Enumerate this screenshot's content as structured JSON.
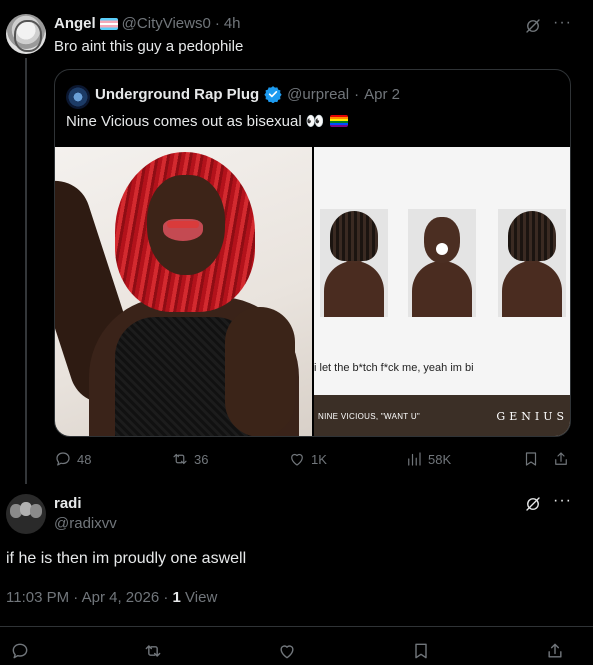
{
  "tweet1": {
    "display_name": "Angel",
    "handle": "@CityViews0",
    "time": "4h",
    "text": "Bro aint this guy a pedophile",
    "actions": {
      "replies": "48",
      "reposts": "36",
      "likes": "1K",
      "views": "58K"
    }
  },
  "quote": {
    "display_name": "Underground Rap Plug",
    "handle": "@urpreal",
    "date": "Apr 2",
    "text": "Nine Vicious comes out as bisexual 👀",
    "media_right": {
      "lyric": "i let the b*tch f*ck me, yeah im bi",
      "song": "NINE VICIOUS, \"WANT U\"",
      "brand": "GENIUS"
    }
  },
  "tweet2": {
    "display_name": "radi",
    "handle": "@radixvv",
    "text": "if he is then im proudly one aswell",
    "time": "11:03 PM",
    "date": "Apr 4, 2026",
    "views_count": "1",
    "views_label": "View"
  },
  "separator": "·",
  "icons": {
    "grok": "grok-icon",
    "more": "more-icon",
    "reply": "reply-icon",
    "repost": "repost-icon",
    "like": "like-icon",
    "views": "views-icon",
    "bookmark": "bookmark-icon",
    "share": "share-icon",
    "verified": "verified-badge-icon"
  },
  "colors": {
    "background": "#000000",
    "text": "#e7e9ea",
    "muted": "#71767b",
    "border": "#2f3336",
    "verified": "#1d9bf0"
  }
}
